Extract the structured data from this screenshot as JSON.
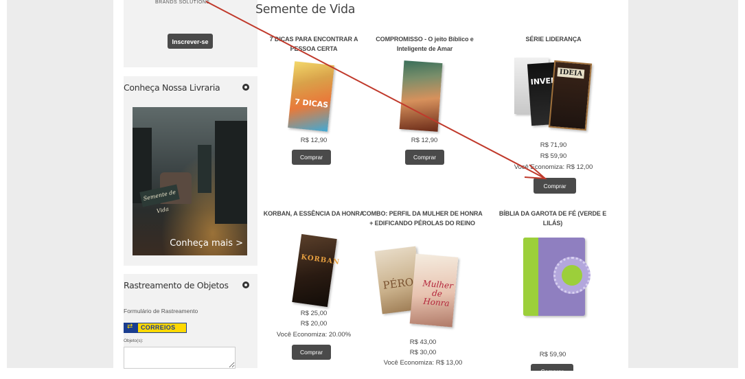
{
  "sidebar": {
    "newsletter": {
      "logo_strip": "BRANDS SOLUTIONS",
      "subscribe_label": "Inscrever-se"
    },
    "store": {
      "title": "Conheça Nossa Livraria",
      "image_sign": "Semente de Vida",
      "cta": "Conheça mais >"
    },
    "tracking": {
      "title": "Rastreamento de Objetos",
      "form_label": "Formulário de Rastreamento",
      "correios": "CORREIOS",
      "objects_label": "Objeto(s):",
      "objects_value": ""
    }
  },
  "main": {
    "title": "Semente de Vida",
    "products": [
      {
        "name": "7 DICAS PARA ENCONTRAR A PESSOA CERTA",
        "cover_label": "7 DICAS",
        "prices": [
          "R$ 12,90"
        ],
        "buy_label": "Comprar"
      },
      {
        "name": "COMPROMISSO - O jeito Bíblico e Inteligente de Amar",
        "cover_label": "",
        "prices": [
          "R$ 12,90"
        ],
        "buy_label": "Comprar"
      },
      {
        "name": "SÉRIE LIDERANÇA",
        "cover_label_1": "INVEN",
        "cover_label_2": "IDEIA",
        "prices": [
          "R$ 71,90",
          "R$ 59,90",
          "Você Economiza: R$ 12,00"
        ],
        "buy_label": "Comprar"
      },
      {
        "name": "KORBAN, A ESSÊNCIA DA HONRA",
        "cover_label": "KORBAN",
        "prices": [
          "R$ 25,00",
          "R$ 20,00",
          "Você Economiza: 20.00%"
        ],
        "buy_label": "Comprar"
      },
      {
        "name": "COMBO: PERFIL DA MULHER DE HONRA + EDIFICANDO PÉROLAS DO REINO",
        "cover_label_1": "PÉRO",
        "cover_label_2": "Mulher de Honra",
        "prices": [
          "R$ 43,00",
          "R$ 30,00",
          "Você Economiza: R$ 13,00"
        ],
        "buy_label": "Comprar"
      },
      {
        "name": "BÍBLIA DA GAROTA DE FÉ (VERDE E LILÁS)",
        "cover_label": "",
        "prices": [
          "R$ 59,90"
        ],
        "buy_label": "Comprar"
      }
    ]
  },
  "colors": {
    "button_bg": "#4a4a4a",
    "annotation_arrow": "#c0392b",
    "side_band": "#ececec",
    "widget_bg": "#f2f2f2"
  }
}
